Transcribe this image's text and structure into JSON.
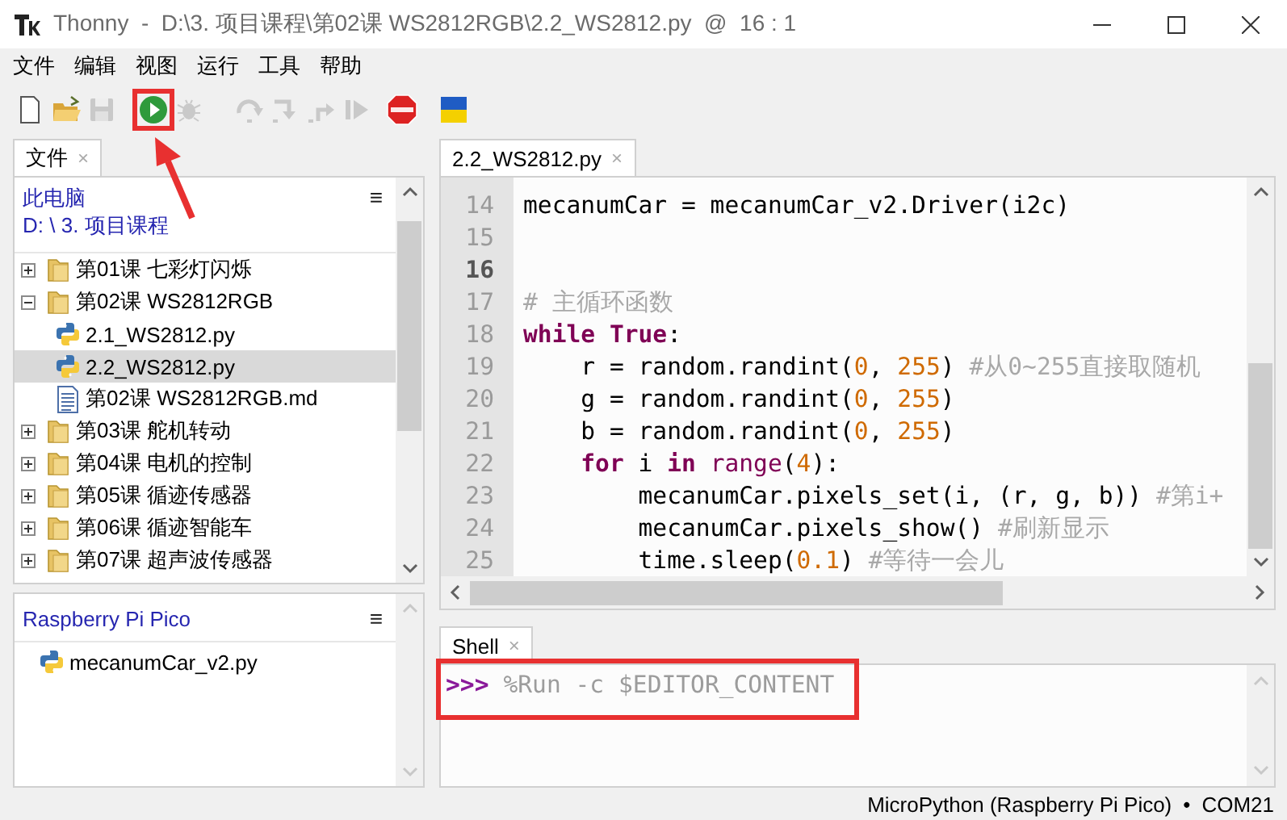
{
  "window": {
    "title": "Thonny  -  D:\\3. 项目课程\\第02课 WS2812RGB\\2.2_WS2812.py  @  16 : 1"
  },
  "menu": [
    "文件",
    "编辑",
    "视图",
    "运行",
    "工具",
    "帮助"
  ],
  "toolbar": [
    {
      "kind": "new",
      "disabled": false,
      "highlighted": false
    },
    {
      "kind": "open",
      "disabled": false,
      "highlighted": false
    },
    {
      "kind": "save",
      "disabled": true,
      "highlighted": false
    },
    {
      "kind": "run",
      "disabled": false,
      "highlighted": true
    },
    {
      "kind": "debug",
      "disabled": true,
      "highlighted": false
    },
    {
      "kind": "step_over",
      "disabled": true,
      "highlighted": false
    },
    {
      "kind": "step_into",
      "disabled": true,
      "highlighted": false
    },
    {
      "kind": "step_out",
      "disabled": true,
      "highlighted": false
    },
    {
      "kind": "resume",
      "disabled": true,
      "highlighted": false
    },
    {
      "kind": "stop",
      "disabled": false,
      "highlighted": false
    },
    {
      "kind": "flag",
      "disabled": false,
      "highlighted": false
    }
  ],
  "annotations": {
    "arrow": true
  },
  "files_panel": {
    "tab": {
      "label": "文件",
      "close": "×"
    },
    "location": [
      "此电脑",
      "D: \\ 3. 项目课程"
    ],
    "menu": "≡",
    "tree": [
      {
        "label": "第01课 七彩灯闪烁",
        "kind": "folder",
        "expanded": false,
        "selected": false
      },
      {
        "label": "第02课 WS2812RGB",
        "kind": "folder",
        "expanded": true,
        "selected": false,
        "children": [
          {
            "label": "2.1_WS2812.py",
            "kind": "python",
            "selected": false
          },
          {
            "label": "2.2_WS2812.py",
            "kind": "python",
            "selected": true
          },
          {
            "label": "第02课 WS2812RGB.md",
            "kind": "text",
            "selected": false
          }
        ]
      },
      {
        "label": "第03课 舵机转动",
        "kind": "folder",
        "expanded": false,
        "selected": false
      },
      {
        "label": "第04课 电机的控制",
        "kind": "folder",
        "expanded": false,
        "selected": false
      },
      {
        "label": "第05课 循迹传感器",
        "kind": "folder",
        "expanded": false,
        "selected": false
      },
      {
        "label": "第06课 循迹智能车",
        "kind": "folder",
        "expanded": false,
        "selected": false
      },
      {
        "label": "第07课 超声波传感器",
        "kind": "folder",
        "expanded": false,
        "selected": false
      }
    ]
  },
  "device_panel": {
    "title": "Raspberry Pi Pico",
    "menu": "≡",
    "files": [
      {
        "label": "mecanumCar_v2.py",
        "kind": "python"
      }
    ]
  },
  "editor": {
    "tab": {
      "label": "2.2_WS2812.py",
      "close": "×"
    },
    "lines": [
      {
        "number": "14",
        "current": false,
        "tokens": [
          {
            "kind": "plain",
            "text": "mecanumCar = mecanumCar_v2.Driver(i2c)"
          }
        ]
      },
      {
        "number": "15",
        "current": false
      },
      {
        "number": "16",
        "current": true
      },
      {
        "number": "17",
        "current": false,
        "tokens": [
          {
            "kind": "comment",
            "text": "# 主循环函数"
          }
        ]
      },
      {
        "number": "18",
        "current": false,
        "tokens": [
          {
            "kind": "keyword",
            "text": "while True"
          },
          {
            "kind": "plain",
            "text": ":"
          }
        ]
      },
      {
        "number": "19",
        "current": false,
        "tokens": [
          {
            "kind": "plain",
            "text": "    r = random.randint("
          },
          {
            "kind": "number",
            "text": "0"
          },
          {
            "kind": "plain",
            "text": ", "
          },
          {
            "kind": "number",
            "text": "255"
          },
          {
            "kind": "plain",
            "text": ") "
          },
          {
            "kind": "comment",
            "text": "#从0~255直接取随机"
          }
        ]
      },
      {
        "number": "20",
        "current": false,
        "tokens": [
          {
            "kind": "plain",
            "text": "    g = random.randint("
          },
          {
            "kind": "number",
            "text": "0"
          },
          {
            "kind": "plain",
            "text": ", "
          },
          {
            "kind": "number",
            "text": "255"
          },
          {
            "kind": "plain",
            "text": ")"
          }
        ]
      },
      {
        "number": "21",
        "current": false,
        "tokens": [
          {
            "kind": "plain",
            "text": "    b = random.randint("
          },
          {
            "kind": "number",
            "text": "0"
          },
          {
            "kind": "plain",
            "text": ", "
          },
          {
            "kind": "number",
            "text": "255"
          },
          {
            "kind": "plain",
            "text": ")"
          }
        ]
      },
      {
        "number": "22",
        "current": false,
        "tokens": [
          {
            "kind": "keyword",
            "text": "    for"
          },
          {
            "kind": "plain",
            "text": " i "
          },
          {
            "kind": "keyword",
            "text": "in "
          },
          {
            "kind": "builtin",
            "text": "range"
          },
          {
            "kind": "plain",
            "text": "("
          },
          {
            "kind": "number",
            "text": "4"
          },
          {
            "kind": "plain",
            "text": "):"
          }
        ]
      },
      {
        "number": "23",
        "current": false,
        "tokens": [
          {
            "kind": "plain",
            "text": "        mecanumCar.pixels_set(i, (r, g, b)) "
          },
          {
            "kind": "comment",
            "text": "#第i+"
          }
        ]
      },
      {
        "number": "24",
        "current": false,
        "tokens": [
          {
            "kind": "plain",
            "text": "        mecanumCar.pixels_show() "
          },
          {
            "kind": "comment",
            "text": "#刷新显示"
          }
        ]
      },
      {
        "number": "25",
        "current": false,
        "tokens": [
          {
            "kind": "plain",
            "text": "        time.sleep("
          },
          {
            "kind": "number",
            "text": "0.1"
          },
          {
            "kind": "plain",
            "text": ") "
          },
          {
            "kind": "comment",
            "text": "#等待一会儿"
          }
        ]
      }
    ]
  },
  "shell": {
    "tab": {
      "label": "Shell",
      "close": "×"
    },
    "prompt": ">>>",
    "command": "%Run -c $EDITOR_CONTENT",
    "highlighted": true
  },
  "status_bar": {
    "interpreter": "MicroPython (Raspberry Pi Pico)",
    "separator": "•",
    "port": "COM21"
  }
}
